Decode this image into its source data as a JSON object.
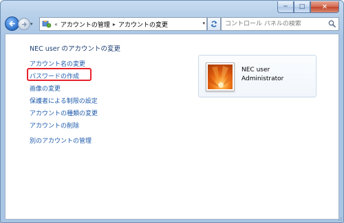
{
  "window": {
    "controls": {
      "minimize": "─",
      "maximize": "□",
      "close": "✕"
    }
  },
  "nav": {
    "address_prefix": "«",
    "breadcrumbs": [
      "アカウントの管理",
      "アカウントの変更"
    ],
    "separator": "▸",
    "search_placeholder": "コントロール パネルの検索"
  },
  "main": {
    "heading": "NEC user のアカウントの変更",
    "tasks": [
      {
        "label": "アカウント名の変更"
      },
      {
        "label": "パスワードの作成",
        "highlighted": true
      },
      {
        "label": "画像の変更"
      },
      {
        "label": "保護者による制限の設定"
      },
      {
        "label": "アカウントの種類の変更"
      },
      {
        "label": "アカウントの削除"
      }
    ],
    "other_link": "別のアカウントの管理"
  },
  "user": {
    "name": "NEC user",
    "role": "Administrator",
    "avatar_icon": "flower-picture-icon"
  },
  "colors": {
    "link": "#1d5aab",
    "highlight_border": "#e8202a",
    "chrome": "#b9d1ea"
  }
}
